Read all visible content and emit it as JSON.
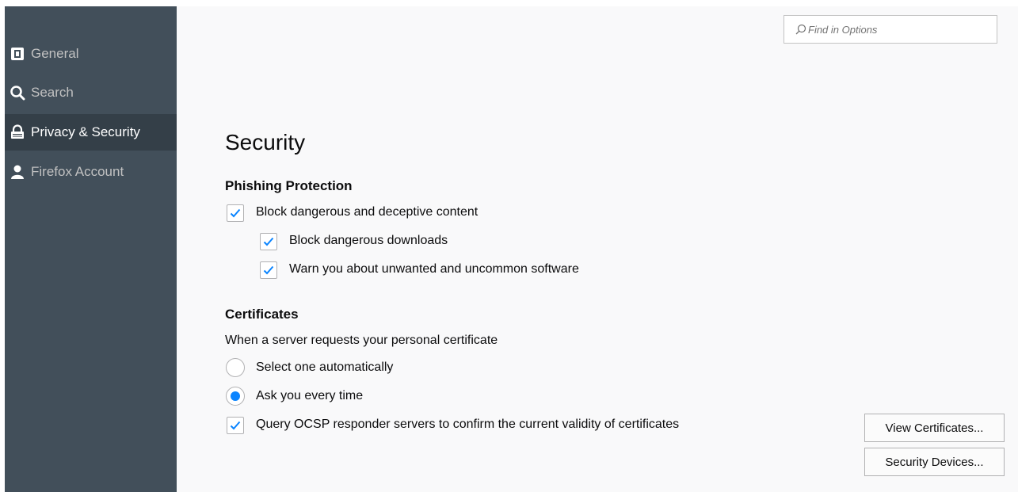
{
  "search": {
    "placeholder": "Find in Options"
  },
  "sidebar": {
    "items": [
      {
        "label": "General",
        "icon": "general-icon",
        "selected": false
      },
      {
        "label": "Search",
        "icon": "search-icon",
        "selected": false
      },
      {
        "label": "Privacy & Security",
        "icon": "lock-icon",
        "selected": true
      },
      {
        "label": "Firefox Account",
        "icon": "account-icon",
        "selected": false
      }
    ]
  },
  "main": {
    "title": "Security",
    "phishing": {
      "heading": "Phishing Protection",
      "block_dangerous": {
        "label": "Block dangerous and deceptive content",
        "checked": true
      },
      "block_downloads": {
        "label": "Block dangerous downloads",
        "checked": true
      },
      "warn_unwanted": {
        "label": "Warn you about unwanted and uncommon software",
        "checked": true
      }
    },
    "certificates": {
      "heading": "Certificates",
      "prompt": "When a server requests your personal certificate",
      "select_auto": {
        "label": "Select one automatically",
        "selected": false
      },
      "ask_every_time": {
        "label": "Ask you every time",
        "selected": true
      },
      "query_ocsp": {
        "label": "Query OCSP responder servers to confirm the current validity of certificates",
        "checked": true
      },
      "view_certificates_label": "View Certificates...",
      "security_devices_label": "Security Devices..."
    }
  },
  "colors": {
    "sidebar_bg": "#424f5a",
    "sidebar_selected_bg": "#343f48",
    "accent": "#0a84ff",
    "page_bg": "#f9f9fa"
  }
}
